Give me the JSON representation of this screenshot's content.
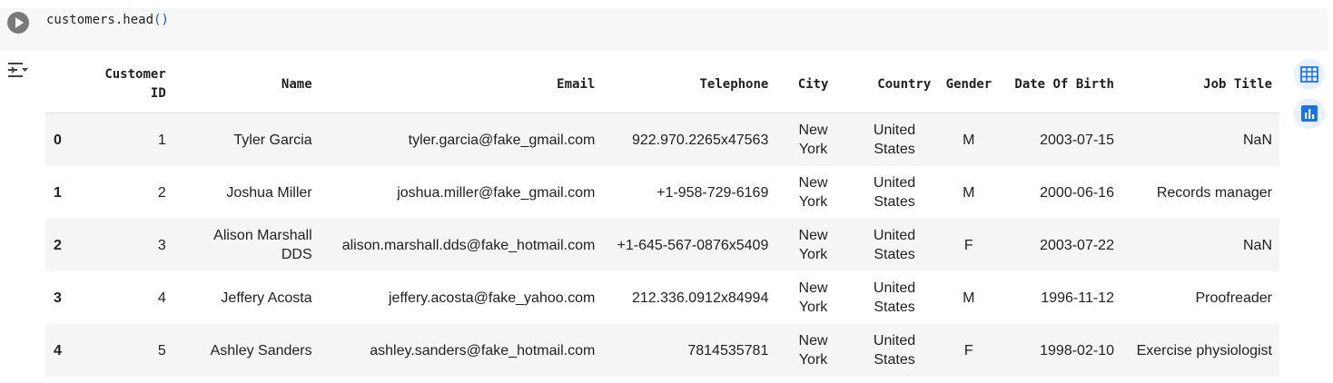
{
  "code": {
    "text": "customers.head",
    "parens": "()"
  },
  "dataframe": {
    "columns": [
      "Customer ID",
      "Name",
      "Email",
      "Telephone",
      "City",
      "Country",
      "Gender",
      "Date Of Birth",
      "Job Title"
    ],
    "rows": [
      {
        "index": "0",
        "cells": [
          "1",
          "Tyler Garcia",
          "tyler.garcia@fake_gmail.com",
          "922.970.2265x47563",
          "New York",
          "United States",
          "M",
          "2003-07-15",
          "NaN"
        ]
      },
      {
        "index": "1",
        "cells": [
          "2",
          "Joshua Miller",
          "joshua.miller@fake_gmail.com",
          "+1-958-729-6169",
          "New York",
          "United States",
          "M",
          "2000-06-16",
          "Records manager"
        ]
      },
      {
        "index": "2",
        "cells": [
          "3",
          "Alison Marshall DDS",
          "alison.marshall.dds@fake_hotmail.com",
          "+1-645-567-0876x5409",
          "New York",
          "United States",
          "F",
          "2003-07-22",
          "NaN"
        ]
      },
      {
        "index": "3",
        "cells": [
          "4",
          "Jeffery Acosta",
          "jeffery.acosta@fake_yahoo.com",
          "212.336.0912x84994",
          "New York",
          "United States",
          "M",
          "1996-11-12",
          "Proofreader"
        ]
      },
      {
        "index": "4",
        "cells": [
          "5",
          "Ashley Sanders",
          "ashley.sanders@fake_hotmail.com",
          "7814535781",
          "New York",
          "United States",
          "F",
          "1998-02-10",
          "Exercise physiologist"
        ]
      }
    ]
  },
  "icons": {
    "run": "play-icon",
    "output_menu": "output-toggle-icon",
    "table_view": "table-icon",
    "chart_suggest": "bar-chart-icon"
  },
  "colors": {
    "accent": "#1a73e8",
    "accent_bg": "#e8f0fe",
    "row_alt": "#f5f5f5",
    "cell_bg": "#f7f7f7"
  }
}
